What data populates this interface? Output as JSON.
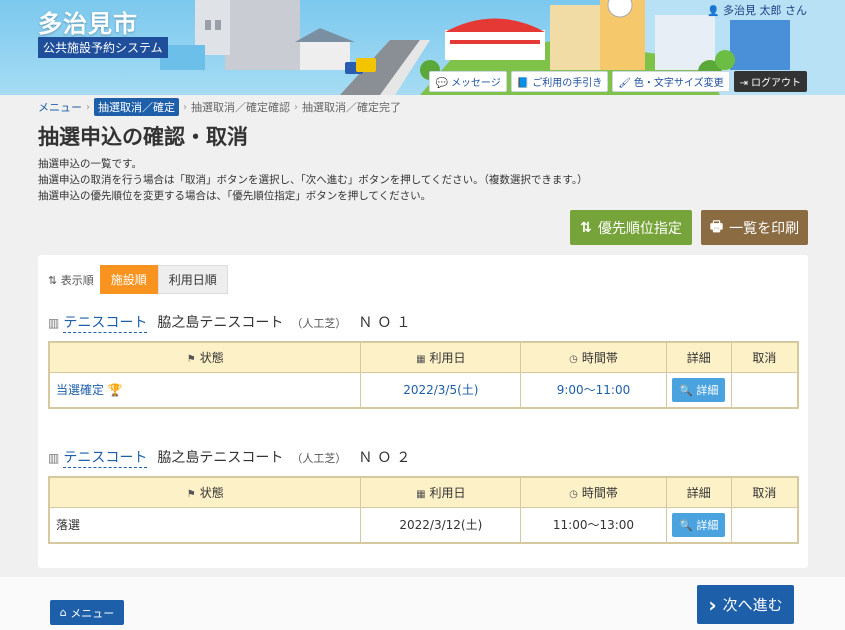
{
  "header": {
    "city_name": "多治見市",
    "system_name": "公共施設予約システム",
    "user_label": "多治見 太郎 さん",
    "buttons": [
      {
        "label": "メッセージ",
        "icon": "chat-icon"
      },
      {
        "label": "ご利用の手引き",
        "icon": "book-icon"
      },
      {
        "label": "色・文字サイズ変更",
        "icon": "brush-icon"
      },
      {
        "label": "ログアウト",
        "icon": "logout-icon"
      }
    ]
  },
  "breadcrumb": {
    "menu": "メニュー",
    "current": "抽選取消／確定",
    "step2": "抽選取消／確定確認",
    "step3": "抽選取消／確定完了"
  },
  "page": {
    "title": "抽選申込の確認・取消",
    "desc1": "抽選申込の一覧です。",
    "desc2": "抽選申込の取消を行う場合は「取消」ボタンを選択し、「次へ進む」ボタンを押してください。（複数選択できます。）",
    "desc3": "抽選申込の優先順位を変更する場合は、「優先順位指定」ボタンを押してください。"
  },
  "actions": {
    "priority_label": "優先順位指定",
    "print_label": "一覧を印刷"
  },
  "sort": {
    "label": "表示順",
    "options": [
      "施設順",
      "利用日順"
    ],
    "selected": "施設順"
  },
  "table_headers": {
    "status": "状態",
    "date": "利用日",
    "time": "時間帯",
    "detail": "詳細",
    "cancel": "取消"
  },
  "facilities": [
    {
      "category": "テニスコート",
      "name": "脇之島テニスコート",
      "surface": "（人工芝）",
      "number": "ＮＯ１",
      "row": {
        "status": "当選確定",
        "date": "2022/3/5(土)",
        "time": "9:00～11:00",
        "detail": "詳細",
        "cancel": ""
      }
    },
    {
      "category": "テニスコート",
      "name": "脇之島テニスコート",
      "surface": "（人工芝）",
      "number": "ＮＯ２",
      "row": {
        "status": "落選",
        "date": "2022/3/12(土)",
        "time": "11:00～13:00",
        "detail": "詳細",
        "cancel": ""
      }
    }
  ],
  "footer": {
    "menu_label": "メニュー",
    "next_label": "次へ進む"
  },
  "colors": {
    "primary": "#1d5fa8",
    "priority": "#76a33a",
    "print": "#8a6b42",
    "sort_active": "#f7931e",
    "table_head": "#fdf1c7"
  }
}
